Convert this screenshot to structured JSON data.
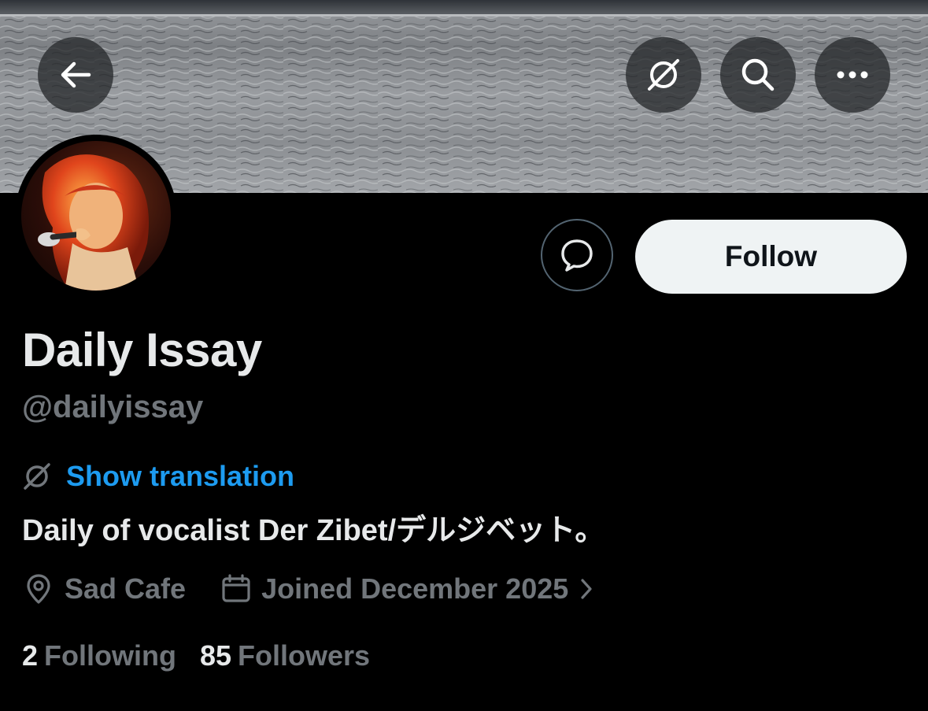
{
  "colors": {
    "background": "#000000",
    "primary_text": "#e7e9ea",
    "secondary_text": "#71767b",
    "accent": "#1d9bf0",
    "follow_button_bg": "#eff3f4",
    "follow_button_text": "#0f1419"
  },
  "header": {
    "back_icon": "arrow-left-icon",
    "translate_icon": "translate-icon",
    "search_icon": "search-icon",
    "more_icon": "more-icon"
  },
  "profile": {
    "display_name": "Daily Issay",
    "handle": "@dailyissay",
    "show_translation": "Show translation",
    "bio": "Daily of vocalist Der Zibet/デルジベット。",
    "location": "Sad Cafe",
    "joined": "Joined December 2025",
    "following_count": "2",
    "following_label": "Following",
    "followers_count": "85",
    "followers_label": "Followers"
  },
  "actions": {
    "message_icon": "message-icon",
    "follow_label": "Follow"
  }
}
